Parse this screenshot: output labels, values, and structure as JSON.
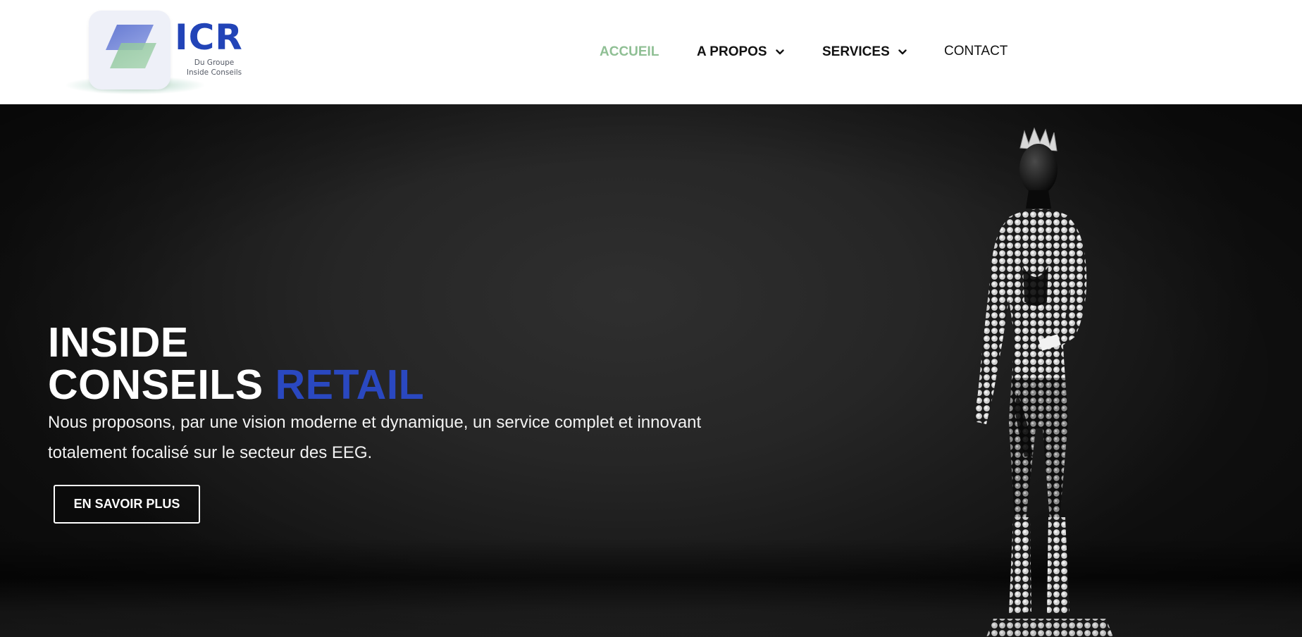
{
  "logo": {
    "name": "ICR",
    "subtitle_line1": "Du Groupe",
    "subtitle_line2": "Inside Conseils",
    "colors": {
      "brand_blue": "#2244b7",
      "brand_green": "#8fc09c"
    }
  },
  "nav": {
    "items": [
      {
        "label": "ACCUEIL",
        "active": true,
        "has_dropdown": false
      },
      {
        "label": "A PROPOS",
        "active": false,
        "has_dropdown": true
      },
      {
        "label": "SERVICES",
        "active": false,
        "has_dropdown": true
      },
      {
        "label": "CONTACT",
        "active": false,
        "has_dropdown": false
      }
    ],
    "active_color": "#8fbf94",
    "text_color": "#121212",
    "dropdown_icon": "chevron-down-icon"
  },
  "hero": {
    "title_line1": "INSIDE",
    "title_line2_plain": "CONSEILS",
    "title_line2_accent": "RETAIL",
    "accent_color": "#2a48c0",
    "description": "Nous proposons, par une vision moderne et dynamique, un service complet et innovant totalement focalisé sur le secteur des EEG.",
    "cta_label": "EN SAVOIR PLUS",
    "image_subject": "mannequin"
  }
}
